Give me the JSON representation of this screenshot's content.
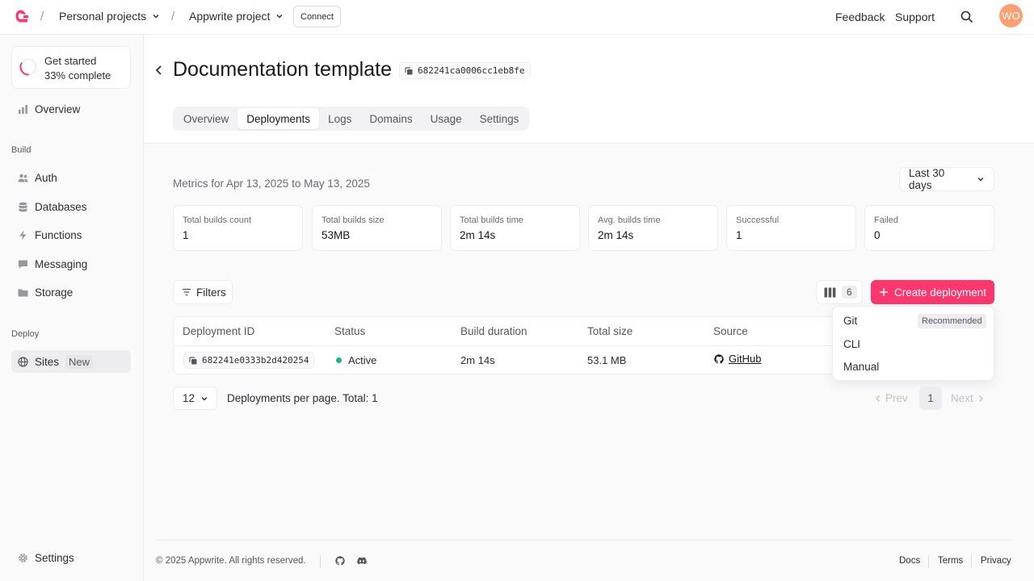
{
  "header": {
    "breadcrumbs": [
      {
        "label": "Personal projects"
      },
      {
        "label": "Appwrite project"
      }
    ],
    "connect_label": "Connect",
    "feedback_label": "Feedback",
    "support_label": "Support",
    "avatar_initials": "WO",
    "brand_color": "#fd366e"
  },
  "sidebar": {
    "get_started": {
      "title": "Get started",
      "progress_text": "33% complete",
      "progress": 0.33
    },
    "overview": "Overview",
    "build_section": "Build",
    "build_items": [
      "Auth",
      "Databases",
      "Functions",
      "Messaging",
      "Storage"
    ],
    "deploy_section": "Deploy",
    "sites_label": "Sites",
    "sites_badge": "New",
    "settings_label": "Settings"
  },
  "page": {
    "title": "Documentation template",
    "site_id": "682241ca0006cc1eb8fe",
    "tabs": [
      "Overview",
      "Deployments",
      "Logs",
      "Domains",
      "Usage",
      "Settings"
    ],
    "active_tab": "Deployments"
  },
  "metrics": {
    "caption": "Metrics for Apr 13, 2025 to May 13, 2025",
    "range": "Last 30 days",
    "cards": [
      {
        "label": "Total builds count",
        "value": "1"
      },
      {
        "label": "Total builds size",
        "value": "53MB"
      },
      {
        "label": "Total builds time",
        "value": "2m 14s"
      },
      {
        "label": "Avg. builds time",
        "value": "2m 14s"
      },
      {
        "label": "Successful",
        "value": "1"
      },
      {
        "label": "Failed",
        "value": "0"
      }
    ]
  },
  "toolbar": {
    "filters_label": "Filters",
    "columns_count": "6",
    "create_label": "Create deployment"
  },
  "table": {
    "headers": [
      "Deployment ID",
      "Status",
      "Build duration",
      "Total size",
      "Source"
    ],
    "rows": [
      {
        "id": "682241e0333b2d420254",
        "status": "Active",
        "build_duration": "2m 14s",
        "total_size": "53.1 MB",
        "source": "GitHub"
      }
    ]
  },
  "create_menu": {
    "items": [
      "Git",
      "CLI",
      "Manual"
    ],
    "git_badge": "Recommended"
  },
  "pagination": {
    "per_page": "12",
    "summary": "Deployments per page. Total: 1",
    "prev": "Prev",
    "next": "Next",
    "current_page": "1"
  },
  "footer": {
    "copyright": "2025 Appwrite. All rights reserved.",
    "links": [
      "Docs",
      "Terms",
      "Privacy"
    ]
  }
}
